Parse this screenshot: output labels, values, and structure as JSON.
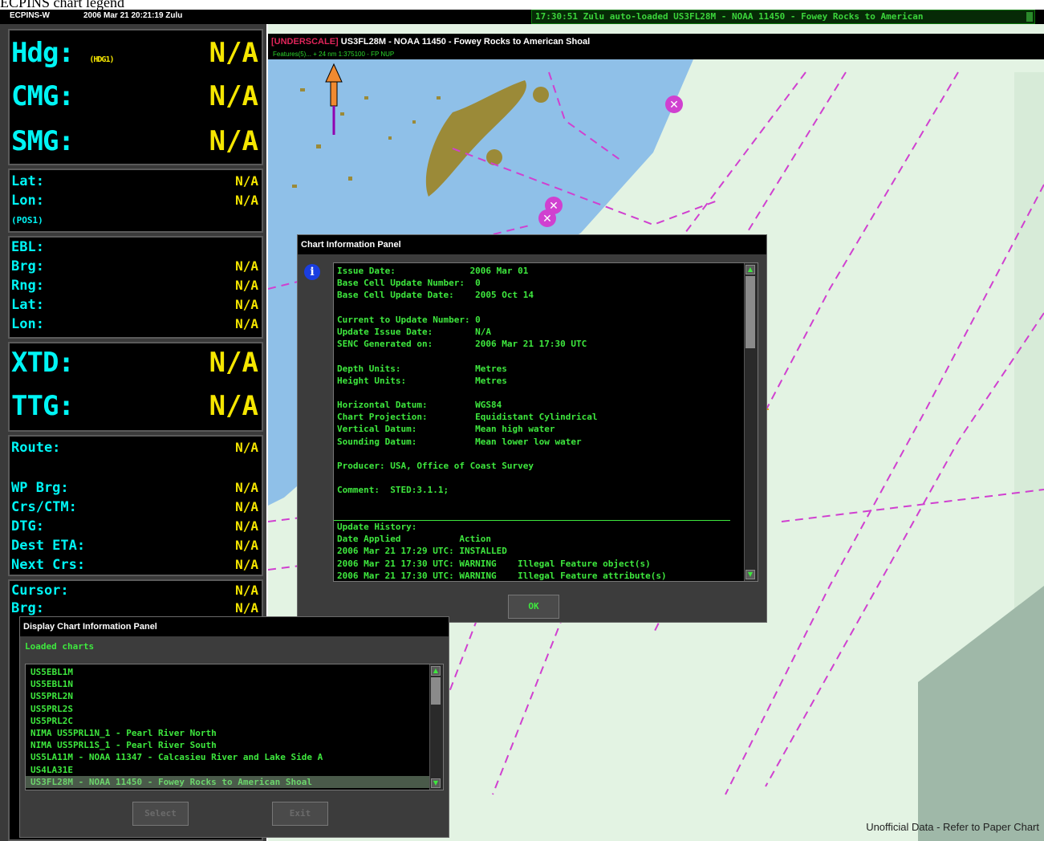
{
  "caption": "ECPINS chart legend",
  "topbar": {
    "app": "ECPINS-W",
    "datetime": "2006 Mar 21   20:21:19 Zulu",
    "status": "17:30:51 Zulu auto-loaded US3FL28M - NOAA 11450 - Fowey Rocks to American"
  },
  "left_panel": {
    "hdg": {
      "label": "Hdg:",
      "sub": "(HDG1)",
      "value": "N/A"
    },
    "cmg": {
      "label": "CMG:",
      "value": "N/A"
    },
    "smg": {
      "label": "SMG:",
      "value": "N/A"
    },
    "pos": {
      "lat_label": "Lat:",
      "lat_value": "N/A",
      "lon_label": "Lon:",
      "lon_value": "N/A",
      "sub": "(POS1)"
    },
    "ebl": {
      "title": "EBL:",
      "rows": [
        {
          "label": "Brg:",
          "value": "N/A"
        },
        {
          "label": "Rng:",
          "value": "N/A"
        },
        {
          "label": "Lat:",
          "value": "N/A"
        },
        {
          "label": "Lon:",
          "value": "N/A"
        }
      ]
    },
    "xtd": {
      "label": "XTD:",
      "value": "N/A"
    },
    "ttg": {
      "label": "TTG:",
      "value": "N/A"
    },
    "route": {
      "title": "Route:",
      "title_value": "N/A",
      "rows": [
        {
          "label": "WP Brg:",
          "value": "N/A"
        },
        {
          "label": "Crs/CTM:",
          "value": "N/A"
        },
        {
          "label": "DTG:",
          "value": "N/A"
        },
        {
          "label": "Dest ETA:",
          "value": "N/A"
        },
        {
          "label": "Next Crs:",
          "value": "N/A"
        }
      ]
    },
    "cursor": {
      "title": "Cursor:",
      "title_value": "N/A",
      "row_label": "Brg:",
      "row_value": "N/A"
    }
  },
  "chart": {
    "underscale": "[UNDERSCALE]",
    "title": " US3FL28M - NOAA 11450 - Fowey Rocks to American Shoal",
    "subtitle": "Features(5)...   +   24 nm   1:375100   -   FP   NUP",
    "unofficial": "Unofficial Data - Refer to Paper Chart"
  },
  "info_panel": {
    "title": "Chart Information Panel",
    "lines": [
      "Issue Date:              2006 Mar 01",
      "Base Cell Update Number:  0",
      "Base Cell Update Date:    2005 Oct 14",
      "",
      "Current to Update Number: 0",
      "Update Issue Date:        N/A",
      "SENC Generated on:        2006 Mar 21 17:30 UTC",
      "",
      "Depth Units:              Metres",
      "Height Units:             Metres",
      "",
      "Horizontal Datum:         WGS84",
      "Chart Projection:         Equidistant Cylindrical",
      "Vertical Datum:           Mean high water",
      "Sounding Datum:           Mean lower low water",
      "",
      "Producer: USA, Office of Coast Survey",
      "",
      "Comment:  STED:3.1.1;",
      "",
      "",
      "Update History:",
      "Date Applied           Action",
      "2006 Mar 21 17:29 UTC: INSTALLED",
      "2006 Mar 21 17:30 UTC: WARNING    Illegal Feature object(s)",
      "2006 Mar 21 17:30 UTC: WARNING    Illegal Feature attribute(s)"
    ],
    "ok_label": "OK"
  },
  "display_panel": {
    "title": "Display Chart Information Panel",
    "heading": "Loaded charts",
    "items": [
      "US5EBL1M",
      "US5EBL1N",
      "US5PRL2N",
      "US5PRL2S",
      "US5PRL2C",
      "NIMA US5PRL1N_1 - Pearl River North",
      "NIMA US5PRL1S_1 - Pearl River South",
      "US5LA11M - NOAA 11347 - Calcasieu River and Lake Side A",
      "US4LA31E",
      "US3FL28M - NOAA 11450 - Fowey Rocks to American Shoal"
    ],
    "select_label": "Select",
    "exit_label": "Exit"
  },
  "colors": {
    "cyan": "#00f5f5",
    "yellow": "#f5e600",
    "term_green": "#3ee83e",
    "land": "#9b8a38",
    "sea": "#8fc0e8",
    "magenta": "#d040d0"
  }
}
